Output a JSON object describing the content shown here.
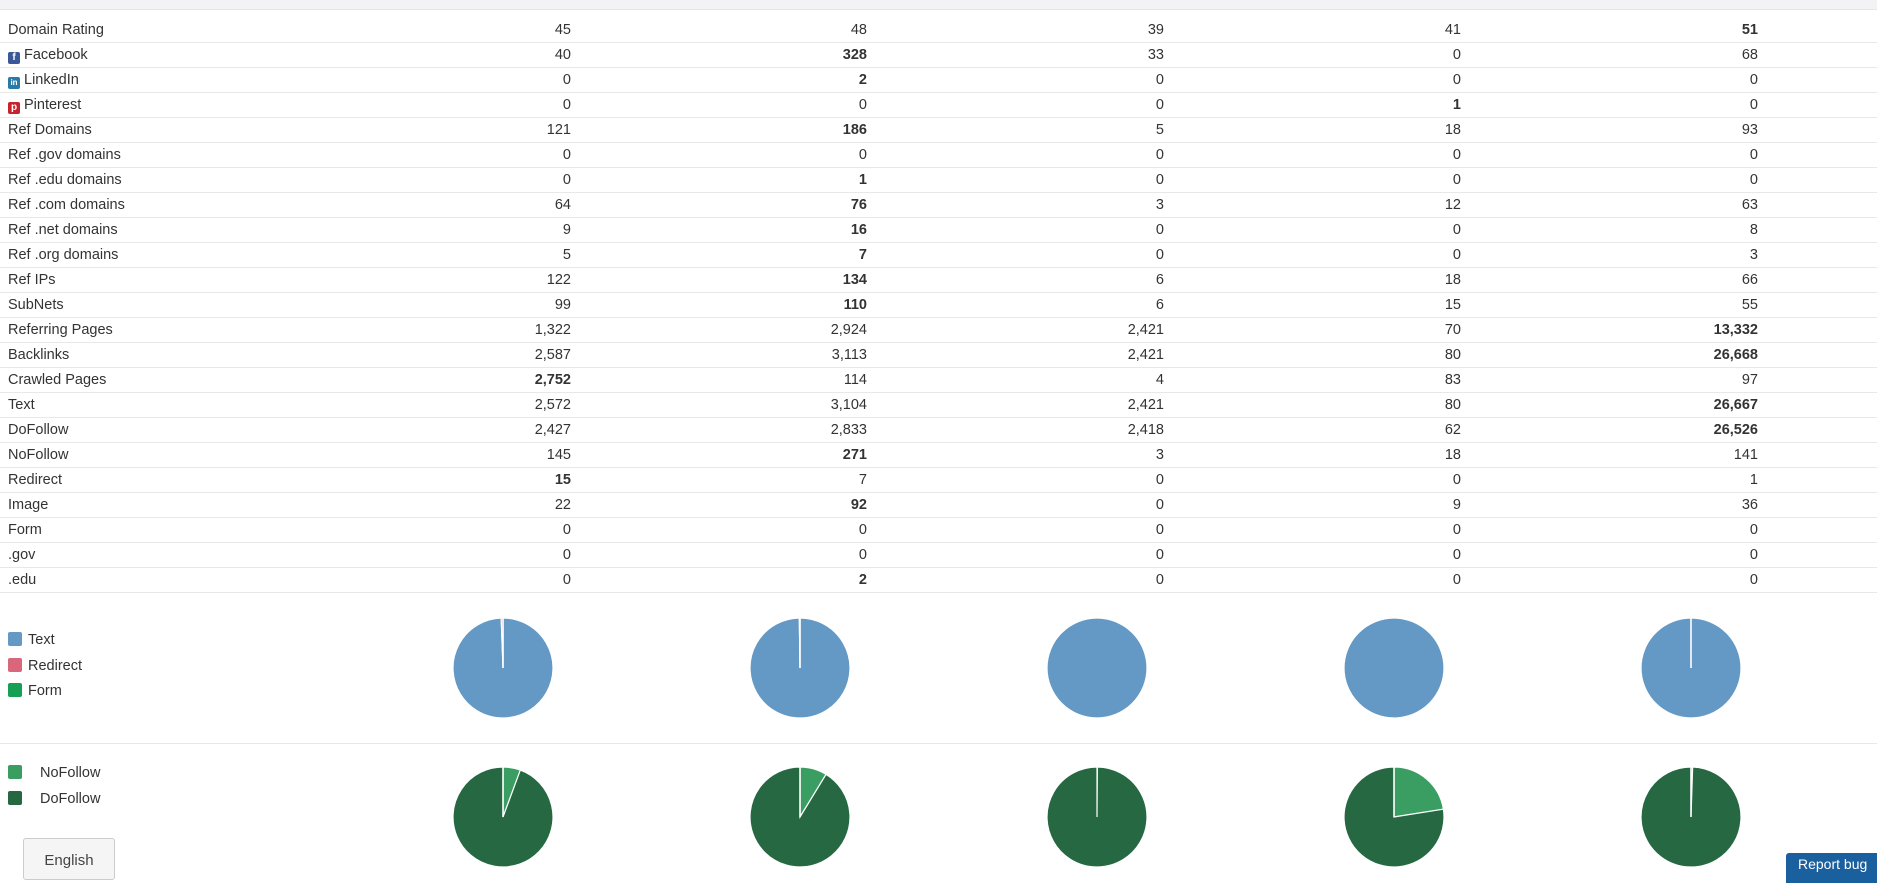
{
  "colors": {
    "text": "#6399c4",
    "redirect": "#d9667a",
    "form": "#15a056",
    "nofollow": "#3a9e62",
    "dofollow": "#256842",
    "facebook": "#3b5998",
    "linkedin": "#2a7aa8",
    "pinterest": "#c8232c"
  },
  "rows": [
    {
      "label": "Domain Rating",
      "values": [
        "45",
        "48",
        "39",
        "41",
        "51"
      ]
    },
    {
      "label": "Facebook",
      "icon": "facebook-icon",
      "values": [
        "40",
        "328",
        "33",
        "0",
        "68"
      ]
    },
    {
      "label": "LinkedIn",
      "icon": "linkedin-icon",
      "values": [
        "0",
        "2",
        "0",
        "0",
        "0"
      ]
    },
    {
      "label": "Pinterest",
      "icon": "pinterest-icon",
      "values": [
        "0",
        "0",
        "0",
        "1",
        "0"
      ]
    },
    {
      "label": "Ref Domains",
      "values": [
        "121",
        "186",
        "5",
        "18",
        "93"
      ]
    },
    {
      "label": "Ref .gov domains",
      "values": [
        "0",
        "0",
        "0",
        "0",
        "0"
      ]
    },
    {
      "label": "Ref .edu domains",
      "values": [
        "0",
        "1",
        "0",
        "0",
        "0"
      ]
    },
    {
      "label": "Ref .com domains",
      "values": [
        "64",
        "76",
        "3",
        "12",
        "63"
      ]
    },
    {
      "label": "Ref .net domains",
      "values": [
        "9",
        "16",
        "0",
        "0",
        "8"
      ]
    },
    {
      "label": "Ref .org domains",
      "values": [
        "5",
        "7",
        "0",
        "0",
        "3"
      ]
    },
    {
      "label": "Ref IPs",
      "values": [
        "122",
        "134",
        "6",
        "18",
        "66"
      ]
    },
    {
      "label": "SubNets",
      "values": [
        "99",
        "110",
        "6",
        "15",
        "55"
      ]
    },
    {
      "label": "Referring Pages",
      "values": [
        "1,322",
        "2,924",
        "2,421",
        "70",
        "13,332"
      ]
    },
    {
      "label": "Backlinks",
      "values": [
        "2,587",
        "3,113",
        "2,421",
        "80",
        "26,668"
      ]
    },
    {
      "label": "Crawled Pages",
      "values": [
        "2,752",
        "114",
        "4",
        "83",
        "97"
      ]
    },
    {
      "label": "Text",
      "values": [
        "2,572",
        "3,104",
        "2,421",
        "80",
        "26,667"
      ]
    },
    {
      "label": "DoFollow",
      "values": [
        "2,427",
        "2,833",
        "2,418",
        "62",
        "26,526"
      ]
    },
    {
      "label": "NoFollow",
      "values": [
        "145",
        "271",
        "3",
        "18",
        "141"
      ]
    },
    {
      "label": "Redirect",
      "values": [
        "15",
        "7",
        "0",
        "0",
        "1"
      ]
    },
    {
      "label": "Image",
      "values": [
        "22",
        "92",
        "0",
        "9",
        "36"
      ]
    },
    {
      "label": "Form",
      "values": [
        "0",
        "0",
        "0",
        "0",
        "0"
      ]
    },
    {
      "label": ".gov",
      "values": [
        "0",
        "0",
        "0",
        "0",
        "0"
      ]
    },
    {
      "label": ".edu",
      "values": [
        "0",
        "2",
        "0",
        "0",
        "0"
      ]
    }
  ],
  "legend_type": [
    "Text",
    "Redirect",
    "Form"
  ],
  "legend_follow": [
    "NoFollow",
    "DoFollow"
  ],
  "chart_data": [
    {
      "type": "pie",
      "series_names": [
        "Text",
        "Redirect",
        "Form"
      ],
      "values": [
        [
          2572,
          15,
          0
        ],
        [
          3104,
          7,
          0
        ],
        [
          2421,
          0,
          0
        ],
        [
          80,
          0,
          0
        ],
        [
          26667,
          1,
          0
        ]
      ]
    },
    {
      "type": "pie",
      "series_names": [
        "NoFollow",
        "DoFollow"
      ],
      "values": [
        [
          145,
          2427
        ],
        [
          271,
          2833
        ],
        [
          3,
          2418
        ],
        [
          18,
          62
        ],
        [
          141,
          26526
        ]
      ]
    }
  ],
  "footer": {
    "language": "English",
    "report_bug": "Report bug"
  }
}
